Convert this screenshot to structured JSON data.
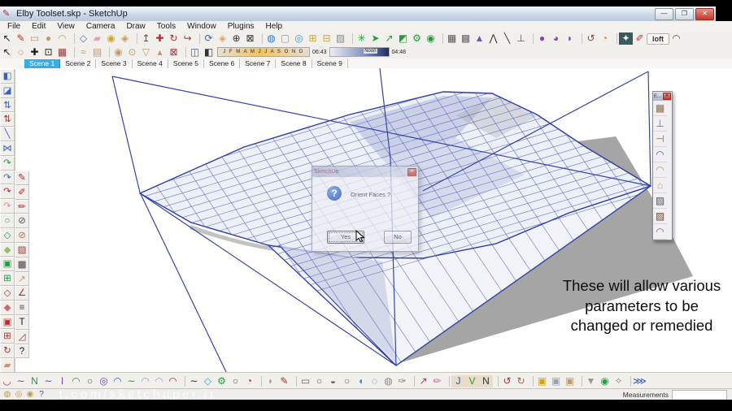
{
  "window": {
    "title": "Elby Toolset.skp - SketchUp",
    "minimize": "—",
    "restore": "❐",
    "close": "✕"
  },
  "menu": {
    "items": [
      "File",
      "Edit",
      "View",
      "Camera",
      "Draw",
      "Tools",
      "Window",
      "Plugins",
      "Help"
    ]
  },
  "toolbar_row1": {
    "icons": [
      {
        "name": "select-tool-icon",
        "glyph": "↖",
        "color": "#1a1a1a"
      },
      {
        "name": "line-tool-icon",
        "glyph": "✎",
        "color": "#b03030"
      },
      {
        "name": "rectangle-tool-icon",
        "glyph": "▭",
        "color": "#c2996a"
      },
      {
        "name": "circle-tool-icon",
        "glyph": "●",
        "color": "#c2996a"
      },
      {
        "name": "arc-tool-icon",
        "glyph": "◠",
        "color": "#c2996a"
      },
      {
        "sep": true
      },
      {
        "name": "make-component-icon",
        "glyph": "◇",
        "color": "#4a6fc4"
      },
      {
        "name": "eraser-icon",
        "glyph": "▰",
        "color": "#e3a3b5"
      },
      {
        "name": "paint-bucket-icon",
        "glyph": "◉",
        "color": "#c8a832"
      },
      {
        "name": "texture-bucket-icon",
        "glyph": "◈",
        "color": "#c2996a"
      },
      {
        "sep": true
      },
      {
        "name": "push-pull-icon",
        "glyph": "↥",
        "color": "#7a4a20"
      },
      {
        "name": "move-tool-icon",
        "glyph": "✚",
        "color": "#b03030"
      },
      {
        "name": "rotate-tool-icon",
        "glyph": "↻",
        "color": "#b03030"
      },
      {
        "name": "follow-me-icon",
        "glyph": "↪",
        "color": "#b03030"
      },
      {
        "sep": true
      },
      {
        "name": "orbit-tool-icon",
        "glyph": "⟳",
        "color": "#3a62c4"
      },
      {
        "name": "pan-tool-icon",
        "glyph": "◈",
        "color": "#d8a878"
      },
      {
        "name": "zoom-tool-icon",
        "glyph": "⊕",
        "color": "#333333"
      },
      {
        "name": "zoom-extents-icon",
        "glyph": "⊠",
        "color": "#333333"
      },
      {
        "sep": true
      },
      {
        "name": "add-location-icon",
        "glyph": "◍",
        "color": "#2a7fd4"
      },
      {
        "name": "toggle-terrain-icon",
        "glyph": "▢",
        "color": "#999999"
      },
      {
        "name": "google-earth-icon",
        "glyph": "◎",
        "color": "#2a9fe0"
      },
      {
        "name": "get-models-icon",
        "glyph": "⊞",
        "color": "#c8a832"
      },
      {
        "name": "share-model-icon",
        "glyph": "⊟",
        "color": "#c8a832"
      },
      {
        "name": "photo-textures-icon",
        "glyph": "▨",
        "color": "#888888"
      },
      {
        "sep": true
      },
      {
        "name": "plugin-green-1-icon",
        "glyph": "✳",
        "color": "#1f9d3a"
      },
      {
        "name": "plugin-green-2-icon",
        "glyph": "➤",
        "color": "#1f9d3a"
      },
      {
        "name": "plugin-green-3-icon",
        "glyph": "↗",
        "color": "#1f9d3a"
      },
      {
        "name": "plugin-green-4-icon",
        "glyph": "◩",
        "color": "#1f9d3a"
      },
      {
        "name": "plugin-green-5-icon",
        "glyph": "⚙",
        "color": "#1f9d3a"
      },
      {
        "name": "plugin-green-6-icon",
        "glyph": "◉",
        "color": "#1f9d3a"
      },
      {
        "sep": true
      },
      {
        "name": "wireframe-box-icon",
        "glyph": "▦",
        "color": "#555555"
      },
      {
        "name": "textured-box-icon",
        "glyph": "▩",
        "color": "#666666"
      },
      {
        "name": "pyramid-tool-icon",
        "glyph": "▲",
        "color": "#6858c8"
      },
      {
        "name": "figure-tool-icon",
        "glyph": "⋀",
        "color": "#333333"
      },
      {
        "name": "pose-tool-icon",
        "glyph": "╲",
        "color": "#333333"
      },
      {
        "name": "component-tool-icon",
        "glyph": "⊥",
        "color": "#555555"
      },
      {
        "sep": true
      },
      {
        "name": "purple-blob-1-icon",
        "glyph": "●",
        "color": "#8a3fb8"
      },
      {
        "name": "purple-blob-2-icon",
        "glyph": "◕",
        "color": "#8a3fb8"
      },
      {
        "name": "purple-blob-3-icon",
        "glyph": "◗",
        "color": "#8a3fb8"
      },
      {
        "sep": true
      },
      {
        "name": "red-loop-icon",
        "glyph": "↺",
        "color": "#c03030"
      },
      {
        "name": "orange-lens-icon",
        "glyph": "◔",
        "color": "#e07820"
      },
      {
        "sep": true
      },
      {
        "name": "dark-panel-icon",
        "glyph": "✦",
        "color": "#ffffff",
        "bg": "#3a5a5e"
      },
      {
        "name": "red-brush-icon",
        "glyph": "✐",
        "color": "#c03030"
      },
      {
        "name": "loft-button",
        "glyph": "loft",
        "color": "#333333",
        "wide": true
      },
      {
        "name": "curve-profile-icon",
        "glyph": "◠",
        "color": "#555555"
      }
    ]
  },
  "toolbar_row2": {
    "icons": [
      {
        "name": "select-tool-2-icon",
        "glyph": "↖",
        "color": "#1a1a1a"
      },
      {
        "name": "lasso-tool-icon",
        "glyph": "◌",
        "color": "#b03030"
      },
      {
        "name": "plus-tool-icon",
        "glyph": "✚",
        "color": "#1a1a1a"
      },
      {
        "name": "zoom-window-icon",
        "glyph": "⊡",
        "color": "#1a1a1a"
      },
      {
        "name": "pattern-tool-icon",
        "glyph": "▦",
        "color": "#a03030"
      },
      {
        "sep": true
      },
      {
        "name": "sandbox-from-contours-icon",
        "glyph": "≈",
        "color": "#c2996a"
      },
      {
        "name": "sandbox-from-scratch-icon",
        "glyph": "▤",
        "color": "#c2996a"
      },
      {
        "sep": true
      },
      {
        "name": "smoove-tool-icon",
        "glyph": "◉",
        "color": "#c2996a"
      },
      {
        "name": "stamp-tool-icon",
        "glyph": "⊙",
        "color": "#c2996a"
      },
      {
        "name": "drape-tool-icon",
        "glyph": "▽",
        "color": "#c2996a"
      },
      {
        "name": "add-detail-icon",
        "glyph": "▴",
        "color": "#c2996a"
      },
      {
        "name": "flip-edge-icon",
        "glyph": "⊠",
        "color": "#b03030"
      },
      {
        "sep": true
      },
      {
        "name": "shadow-toggle-icon",
        "glyph": "◫",
        "color": "#3a62c4"
      },
      {
        "name": "shadow-settings-icon",
        "glyph": "◧",
        "color": "#333333"
      }
    ],
    "shadow": {
      "months": "J F M A M J J A S O N D",
      "time_start": "06:43",
      "noon": "Noon",
      "time_end": "04:48"
    }
  },
  "scenes": {
    "tabs": [
      "Scene 1",
      "Scene 2",
      "Scene 3",
      "Scene 4",
      "Scene 5",
      "Scene 6",
      "Scene 7",
      "Scene 8",
      "Scene 9"
    ]
  },
  "left_toolbar_col1": {
    "icons": [
      {
        "name": "sandbox-flag-blue-icon",
        "glyph": "◧",
        "color": "#3a62c4"
      },
      {
        "name": "sandbox-flag-icon",
        "glyph": "◪",
        "color": "#3a62c4"
      },
      {
        "name": "arrows-up-down-blue-icon",
        "glyph": "⇅",
        "color": "#3a62c4"
      },
      {
        "name": "arrows-up-down-red-icon",
        "glyph": "⇅",
        "color": "#b03030"
      },
      {
        "name": "diagonal-line-icon",
        "glyph": "╲",
        "color": "#3a62c4"
      },
      {
        "name": "bowtie-icon",
        "glyph": "⋈",
        "color": "#3a62c4"
      },
      {
        "name": "curve-green-icon",
        "glyph": "↷",
        "color": "#1f9d3a"
      },
      {
        "name": "curve-blue-icon",
        "glyph": "↷",
        "color": "#3a62c4"
      },
      {
        "name": "curve-red-icon",
        "glyph": "↷",
        "color": "#b03030"
      },
      {
        "name": "curve-pink-icon",
        "glyph": "↷",
        "color": "#e08aa0"
      },
      {
        "name": "circle-green-icon",
        "glyph": "○",
        "color": "#1f9d3a"
      },
      {
        "name": "diamond-outline-green-icon",
        "glyph": "◇",
        "color": "#1f9d3a"
      },
      {
        "name": "diamond-green-icon",
        "glyph": "◆",
        "color": "#8fbf6f"
      },
      {
        "name": "cube-green-icon",
        "glyph": "▣",
        "color": "#1f9d3a"
      },
      {
        "name": "cubes-green-icon",
        "glyph": "⊞",
        "color": "#1f9d3a"
      },
      {
        "name": "diamond-outline-red-icon",
        "glyph": "◇",
        "color": "#b03030"
      },
      {
        "name": "diamond-red-icon",
        "glyph": "◆",
        "color": "#d06a6a"
      },
      {
        "name": "cube-red-icon",
        "glyph": "▣",
        "color": "#b03030"
      },
      {
        "name": "cubes-red-icon",
        "glyph": "⊞",
        "color": "#b03030"
      },
      {
        "name": "rotate-red-icon",
        "glyph": "↻",
        "color": "#b03030"
      },
      {
        "name": "eraser-tan-icon",
        "glyph": "▰",
        "color": "#c2996a"
      },
      {
        "name": "mini-help-icon",
        "glyph": "?",
        "color": "#333333"
      }
    ]
  },
  "left_toolbar_col2": {
    "icons": [
      {
        "name": "pencil-z-icon",
        "glyph": "✎",
        "color": "#b03030"
      },
      {
        "name": "pencil-angle-icon",
        "glyph": "✐",
        "color": "#b03030"
      },
      {
        "name": "pencil-box-icon",
        "glyph": "✏",
        "color": "#b03030"
      },
      {
        "name": "circle-pencil-icon",
        "glyph": "⊘",
        "color": "#555555"
      },
      {
        "name": "circle-slash-icon",
        "glyph": "⊘",
        "color": "#b07050"
      },
      {
        "name": "grid-red-icon",
        "glyph": "▨",
        "color": "#b03030"
      },
      {
        "name": "grid-dark-icon",
        "glyph": "▩",
        "color": "#444444"
      },
      {
        "name": "slope-pencil-icon",
        "glyph": "↗",
        "color": "#c2996a"
      },
      {
        "name": "angle-red-icon",
        "glyph": "∠",
        "color": "#b03030"
      },
      {
        "name": "dashes-icon",
        "glyph": "≡",
        "color": "#333333"
      },
      {
        "name": "text-tool-icon",
        "glyph": "T",
        "color": "#1a1a1a"
      },
      {
        "name": "angle-measure-icon",
        "glyph": "◿",
        "color": "#b03030"
      },
      {
        "name": "question-mark-icon",
        "glyph": "?",
        "color": "#1a1a1a"
      }
    ]
  },
  "palette": {
    "title": "E...",
    "close": "✕",
    "icons": [
      {
        "name": "elby-roof-grid-icon",
        "glyph": "▦",
        "color": "#8a6a4a"
      },
      {
        "name": "elby-handle-1-icon",
        "glyph": "⊥",
        "color": "#8a6a4a"
      },
      {
        "name": "elby-handle-2-icon",
        "glyph": "⊣",
        "color": "#8a6a4a"
      },
      {
        "name": "elby-roof-blue-icon",
        "glyph": "◠",
        "color": "#3a62c4"
      },
      {
        "name": "elby-roof-light-icon",
        "glyph": "◠",
        "color": "#c2996a"
      },
      {
        "name": "elby-roof-house-icon",
        "glyph": "⌂",
        "color": "#c2996a"
      },
      {
        "name": "elby-roof-dark-1-icon",
        "glyph": "▨",
        "color": "#555555"
      },
      {
        "name": "elby-roof-dark-2-icon",
        "glyph": "▨",
        "color": "#6a4a2a"
      },
      {
        "name": "elby-roof-curve-icon",
        "glyph": "◠",
        "color": "#8a6a4a"
      }
    ]
  },
  "dialog": {
    "title": "SketchUp",
    "message": "Orient Faces ?",
    "yes": "Yes",
    "no": "No",
    "close": "✕"
  },
  "annotation": {
    "line1": "These will allow various",
    "line2": "parameters to be",
    "line3": "changed or remedied"
  },
  "bottom_toolbar": {
    "icons": [
      {
        "name": "bezier-smile-icon",
        "glyph": "◡",
        "color": "#b03030"
      },
      {
        "name": "bezier-wave-purple-icon",
        "glyph": "∼",
        "color": "#7a3fb8"
      },
      {
        "name": "bezier-n-green-icon",
        "glyph": "N",
        "color": "#1f9d3a"
      },
      {
        "name": "bezier-wave-2-icon",
        "glyph": "∼",
        "color": "#7a3fb8"
      },
      {
        "name": "bezier-i-icon",
        "glyph": "I",
        "color": "#7a3fb8"
      },
      {
        "name": "bezier-arc-green-icon",
        "glyph": "◠",
        "color": "#1f9d3a"
      },
      {
        "name": "bezier-blob-icon",
        "glyph": "○",
        "color": "#555555"
      },
      {
        "name": "bezier-spiral-icon",
        "glyph": "◎",
        "color": "#7a3fb8"
      },
      {
        "name": "bezier-arc-blue-icon",
        "glyph": "◠",
        "color": "#3a62c4"
      },
      {
        "name": "bezier-wave-green-icon",
        "glyph": "∼",
        "color": "#1f9d3a"
      },
      {
        "name": "bezier-dome-1-icon",
        "glyph": "◠",
        "color": "#9a9ad0"
      },
      {
        "name": "bezier-dome-2-icon",
        "glyph": "◠",
        "color": "#9a9ad0"
      },
      {
        "name": "bezier-arc-red-icon",
        "glyph": "◠",
        "color": "#b03030"
      },
      {
        "sep": true
      },
      {
        "name": "polyline-dark-icon",
        "glyph": "∼",
        "color": "#333333"
      },
      {
        "name": "dotted-polygon-icon",
        "glyph": "◇",
        "color": "#3a9ad0"
      },
      {
        "name": "wrench-icon",
        "glyph": "⚙",
        "color": "#1f9d3a"
      },
      {
        "name": "ellipse-red-icon",
        "glyph": "○",
        "color": "#b03030"
      },
      {
        "name": "quarter-red-icon",
        "glyph": "◔",
        "color": "#b03030"
      },
      {
        "sep": true
      },
      {
        "name": "tan-blob-icon",
        "glyph": "◗",
        "color": "#c2996a"
      },
      {
        "name": "red-pencil-icon",
        "glyph": "✎",
        "color": "#b03030"
      },
      {
        "sep": true
      },
      {
        "name": "shape-rect-icon",
        "glyph": "▭",
        "color": "#666666"
      },
      {
        "name": "shape-oval-1-icon",
        "glyph": "○",
        "color": "#666666"
      },
      {
        "name": "shape-oval-2-icon",
        "glyph": "◒",
        "color": "#666666"
      },
      {
        "name": "shape-oval-3-icon",
        "glyph": "○",
        "color": "#666666"
      },
      {
        "name": "shape-half-icon",
        "glyph": "◖",
        "color": "#3a86c8"
      },
      {
        "name": "lasso-blue-icon",
        "glyph": "◌",
        "color": "#3a62c4"
      },
      {
        "name": "lasso-gray-icon",
        "glyph": "◍",
        "color": "#888888"
      },
      {
        "name": "pen-flag-icon",
        "glyph": "✑",
        "color": "#777777"
      },
      {
        "sep": true
      },
      {
        "name": "red-arrow-icon",
        "glyph": "↗",
        "color": "#c03030"
      },
      {
        "name": "pink-wand-icon",
        "glyph": "✏",
        "color": "#d060a0"
      },
      {
        "sep": true
      },
      {
        "name": "drop-j-icon",
        "glyph": "J",
        "color": "#2a52be",
        "bg": "#e8ddc8"
      },
      {
        "name": "drop-v-icon",
        "glyph": "V",
        "color": "#1f9d3a",
        "bg": "#e8ddc8"
      },
      {
        "name": "drop-n-icon",
        "glyph": "N",
        "color": "#333333",
        "bg": "#e8ddc8"
      },
      {
        "sep": true
      },
      {
        "name": "curve-arrow-1-icon",
        "glyph": "↺",
        "color": "#b03030"
      },
      {
        "name": "curve-arrow-2-icon",
        "glyph": "↻",
        "color": "#b06030"
      },
      {
        "sep": true
      },
      {
        "name": "box-gold-icon",
        "glyph": "▣",
        "color": "#d4a017"
      },
      {
        "name": "box-silver-icon",
        "glyph": "▣",
        "color": "#9aa0b8"
      },
      {
        "name": "box-tan-icon",
        "glyph": "▣",
        "color": "#c2996a"
      },
      {
        "sep": true
      },
      {
        "name": "shield-icon",
        "glyph": "▼",
        "color": "#999999"
      },
      {
        "name": "bag-icon",
        "glyph": "◉",
        "color": "#1f9d3a"
      },
      {
        "name": "crumple-icon",
        "glyph": "✧",
        "color": "#888888"
      },
      {
        "sep": true
      },
      {
        "name": "divider-tool-icon",
        "glyph": "⋙",
        "color": "#2a52be"
      }
    ]
  },
  "status": {
    "geo_icons": [
      {
        "name": "geo-coin-1-icon",
        "glyph": "◍",
        "color": "#b89a5a"
      },
      {
        "name": "geo-coin-2-icon",
        "glyph": "◎",
        "color": "#b89a5a"
      },
      {
        "name": "geo-coin-3-icon",
        "glyph": "◉",
        "color": "#b89a5a"
      },
      {
        "name": "status-help-icon",
        "glyph": "?",
        "color": "#2a52be"
      }
    ],
    "watermark": "t.com/sketchuper.ir",
    "measurements_label": "Measurements"
  },
  "colors": {
    "edge_blue": "#3346a8",
    "mesh_fill": "#eef0f8",
    "shadow_gray": "#a5a5a5",
    "tab_active": "#35aee8"
  }
}
